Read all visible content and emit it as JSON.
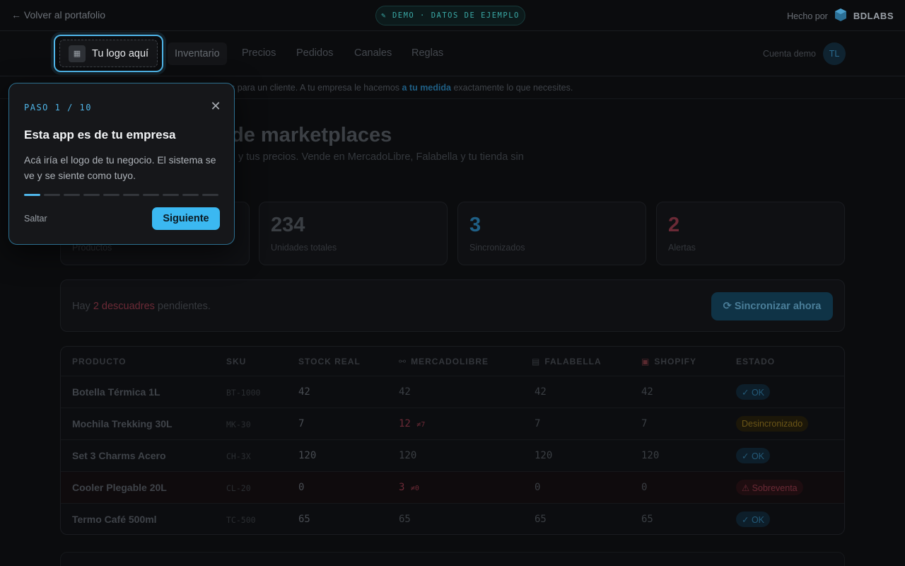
{
  "topbar": {
    "back_label": "← Volver al portafolio",
    "demo_label": "DEMO · DATOS DE EJEMPLO",
    "made_by": "Hecho por",
    "brand": "BDLABS"
  },
  "nav": {
    "logo_placeholder": "Tu logo aquí",
    "tabs": [
      "Inventario",
      "Precios",
      "Pedidos",
      "Canales",
      "Reglas"
    ],
    "account_label": "Cuenta demo",
    "avatar_initials": "TL"
  },
  "info": {
    "text_before": "s para un cliente. A tu empresa le hacemos ",
    "highlight": "a tu medida",
    "text_after": " exactamente lo que necesites."
  },
  "page": {
    "title": "de marketplaces",
    "subtitle": "y tus precios. Vende en MercadoLibre, Falabella y tu tienda sin"
  },
  "stats": [
    {
      "value": "",
      "label": "Productos",
      "color": "#3a3e43"
    },
    {
      "value": "234",
      "label": "Unidades totales",
      "color": "#3a3e43"
    },
    {
      "value": "3",
      "label": "Sincronizados",
      "color": "#1f5f85"
    },
    {
      "value": "2",
      "label": "Alertas",
      "color": "#6b2a36"
    }
  ],
  "pending": {
    "before": "Hay ",
    "highlight": "2 descuadres",
    "after": " pendientes.",
    "sync_button": "⟳ Sincronizar ahora"
  },
  "table": {
    "headers": [
      "PRODUCTO",
      "SKU",
      "STOCK REAL",
      "MERCADOLIBRE",
      "FALABELLA",
      "SHOPIFY",
      "ESTADO"
    ],
    "rows": [
      {
        "product": "Botella Térmica 1L",
        "sku": "BT-1000",
        "stock": "42",
        "ml": "42",
        "ml_diff": "",
        "fa": "42",
        "sh": "42",
        "status": "✓ OK",
        "status_type": "ok"
      },
      {
        "product": "Mochila Trekking 30L",
        "sku": "MK-30",
        "stock": "7",
        "ml": "12",
        "ml_diff": "≠7",
        "fa": "7",
        "sh": "7",
        "status": "Desincronizado",
        "status_type": "warn"
      },
      {
        "product": "Set 3 Charms Acero",
        "sku": "CH-3X",
        "stock": "120",
        "ml": "120",
        "ml_diff": "",
        "fa": "120",
        "sh": "120",
        "status": "✓ OK",
        "status_type": "ok"
      },
      {
        "product": "Cooler Plegable 20L",
        "sku": "CL-20",
        "stock": "0",
        "ml": "3",
        "ml_diff": "≠0",
        "fa": "0",
        "sh": "0",
        "status": "⚠ Sobreventa",
        "status_type": "over"
      },
      {
        "product": "Termo Café 500ml",
        "sku": "TC-500",
        "stock": "65",
        "ml": "65",
        "ml_diff": "",
        "fa": "65",
        "sh": "65",
        "status": "✓ OK",
        "status_type": "ok"
      }
    ]
  },
  "tour": {
    "step": "PASO 1 / 10",
    "title": "Esta app es de tu empresa",
    "body": "Acá iría el logo de tu negocio. El sistema se ve y se siente como tuyo.",
    "skip": "Saltar",
    "next": "Siguiente",
    "total_steps": 10,
    "current_step": 1
  },
  "colors": {
    "accent": "#3bb8f1",
    "ok": "#245a78",
    "warn": "#6b5517",
    "alert": "#6b2a36"
  }
}
